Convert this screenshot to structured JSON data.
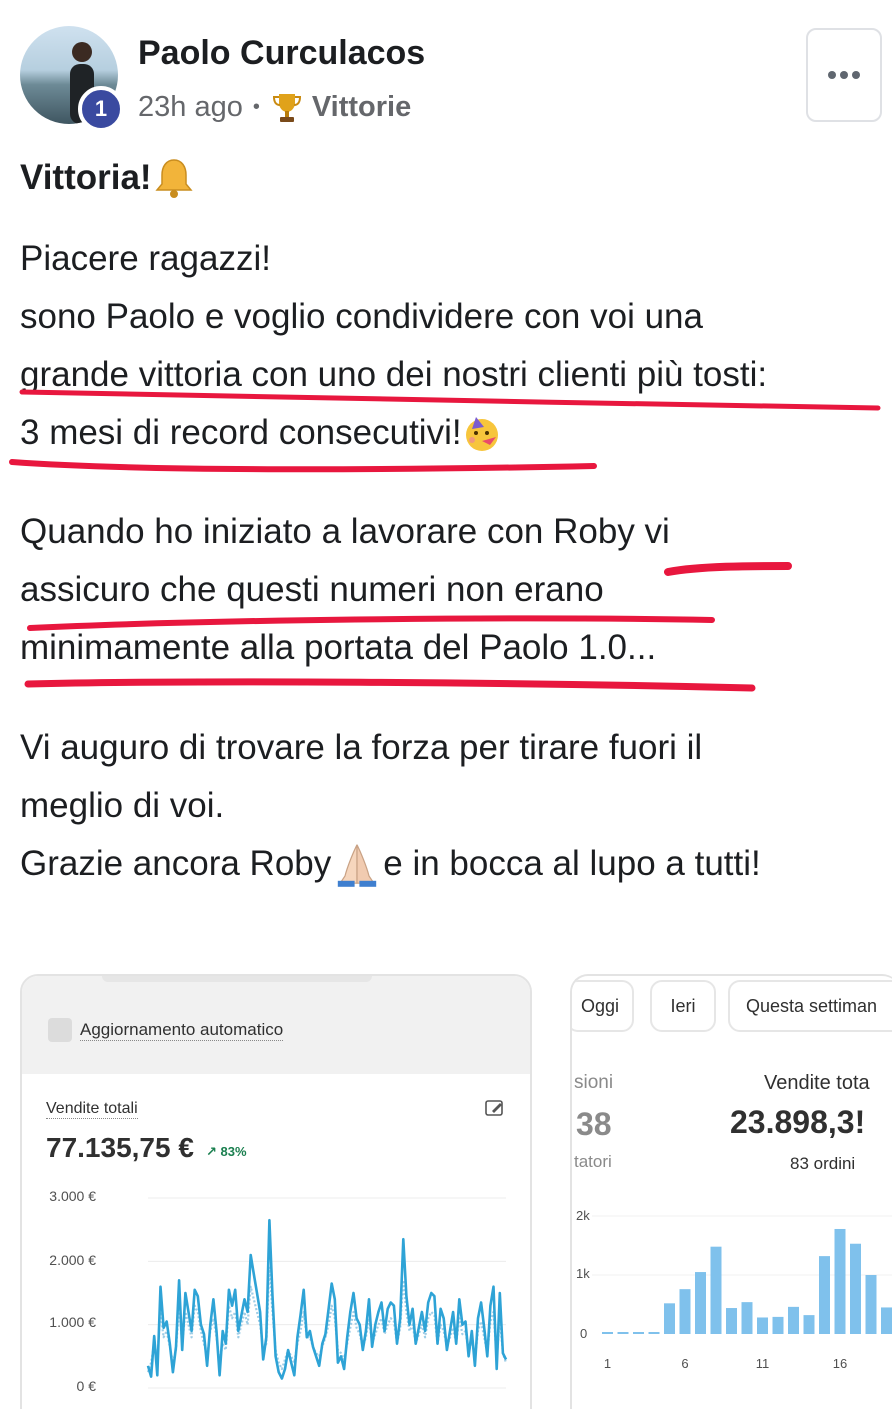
{
  "post": {
    "author": "Paolo Curculacos",
    "badge_level": "1",
    "time": "23h ago",
    "separator": "•",
    "category": "Vittorie",
    "title": "Vittoria!",
    "paragraphs": [
      [
        "Piacere ragazzi!",
        "sono Paolo e voglio condividere con voi una",
        "grande vittoria con uno dei nostri clienti più tosti:",
        "3 mesi di record consecutivi!"
      ],
      [
        "Quando ho iniziato a lavorare con Roby vi",
        "assicuro che questi numeri non erano",
        "minimamente alla portata del Paolo 1.0..."
      ],
      [
        "Vi auguro di trovare la forza per tirare fuori il",
        "meglio di voi.",
        "Grazie ancora Roby",
        "e in bocca al lupo a tutti!"
      ]
    ],
    "icons": {
      "more": "more-dots-icon",
      "category": "trophy-icon",
      "title_emoji": "bell-icon",
      "party_emoji": "party-face-icon",
      "pray_emoji": "folded-hands-icon"
    },
    "annotation_color": "#e8173e"
  },
  "screenshot_left": {
    "auto_update_label": "Aggiornamento automatico",
    "metric_label": "Vendite totali",
    "metric_value": "77.135,75 €",
    "metric_delta": "↗ 83%",
    "chart_data": {
      "type": "line",
      "y_ticks": [
        "3.000 €",
        "2.000 €",
        "1.000 €",
        "0 €"
      ],
      "ylim": [
        0,
        3000
      ],
      "series": [
        {
          "style": "solid",
          "color": "#2ea3d6",
          "values": [
            350,
            180,
            820,
            200,
            1600,
            950,
            1050,
            700,
            250,
            650,
            1700,
            600,
            1500,
            1200,
            900,
            1550,
            1450,
            1000,
            850,
            350,
            1000,
            1400,
            900,
            200,
            900,
            700,
            1550,
            1300,
            1550,
            900,
            1150,
            1400,
            1200,
            2100,
            1800,
            1500,
            1200,
            450,
            800,
            2650,
            1450,
            500,
            250,
            150,
            300,
            600,
            400,
            200,
            800,
            1150,
            1550,
            800,
            900,
            650,
            500,
            350,
            700,
            850,
            1250,
            1650,
            1400,
            400,
            500,
            300,
            800,
            1200,
            1500,
            1100,
            1000,
            600,
            900,
            1400,
            650,
            1000,
            1200,
            1350,
            900,
            1250,
            1350,
            1300,
            700,
            1100,
            2350,
            1450,
            1000,
            1250,
            700,
            950,
            1200,
            900,
            1350,
            1500,
            1450,
            700,
            1250,
            1100,
            600,
            900,
            1200,
            700,
            1400,
            1000,
            1050,
            500,
            900,
            350,
            1100,
            1350,
            950,
            500,
            1300,
            1600,
            300,
            1500,
            550,
            450
          ]
        },
        {
          "style": "dotted",
          "color": "#9fcde6",
          "values": [
            250,
            400,
            700,
            500,
            1200,
            800,
            900,
            650,
            400,
            600,
            1300,
            700,
            1200,
            1000,
            800,
            1300,
            1200,
            900,
            700,
            500,
            900,
            1100,
            800,
            400,
            700,
            600,
            1300,
            1100,
            1200,
            800,
            1000,
            1200,
            1000,
            1600,
            1400,
            1200,
            1000,
            600,
            700,
            1900,
            1200,
            600,
            400,
            300,
            450,
            600,
            500,
            400,
            700,
            900,
            1200,
            800,
            800,
            650,
            550,
            500,
            650,
            800,
            1000,
            1300,
            1100,
            600,
            550,
            450,
            700,
            950,
            1200,
            950,
            850,
            650,
            800,
            1100,
            700,
            850,
            1000,
            1100,
            850,
            1000,
            1100,
            1050,
            700,
            950,
            1700,
            1200,
            900,
            1000,
            700,
            850,
            1000,
            800,
            1100,
            1200,
            1150,
            700,
            1000,
            900,
            650,
            800,
            950,
            700,
            1100,
            850,
            900,
            550,
            750,
            450,
            900,
            1050,
            800,
            550,
            1050,
            1200,
            450,
            1100,
            550,
            400
          ]
        }
      ]
    }
  },
  "screenshot_right": {
    "tabs": [
      "Oggi",
      "Ieri",
      "Questa settiman"
    ],
    "left_col": {
      "sub1": "sioni",
      "value": "38",
      "sub2": "tatori"
    },
    "right_col": {
      "label": "Vendite tota",
      "value": "23.898,3!",
      "orders": "83 ordini"
    },
    "chart_data": {
      "type": "bar",
      "y_ticks": [
        "2k",
        "1k",
        "0"
      ],
      "ylim": [
        0,
        2000
      ],
      "x_ticks": [
        "1",
        "6",
        "11",
        "16"
      ],
      "x": [
        1,
        2,
        3,
        4,
        5,
        6,
        7,
        8,
        9,
        10,
        11,
        12,
        13,
        14,
        15,
        16,
        17,
        18,
        19,
        20
      ],
      "values": [
        0,
        20,
        20,
        0,
        520,
        760,
        1050,
        1480,
        440,
        540,
        280,
        290,
        460,
        320,
        1320,
        1780,
        1530,
        1000,
        450,
        690
      ],
      "color": "#7fc1ec"
    }
  }
}
